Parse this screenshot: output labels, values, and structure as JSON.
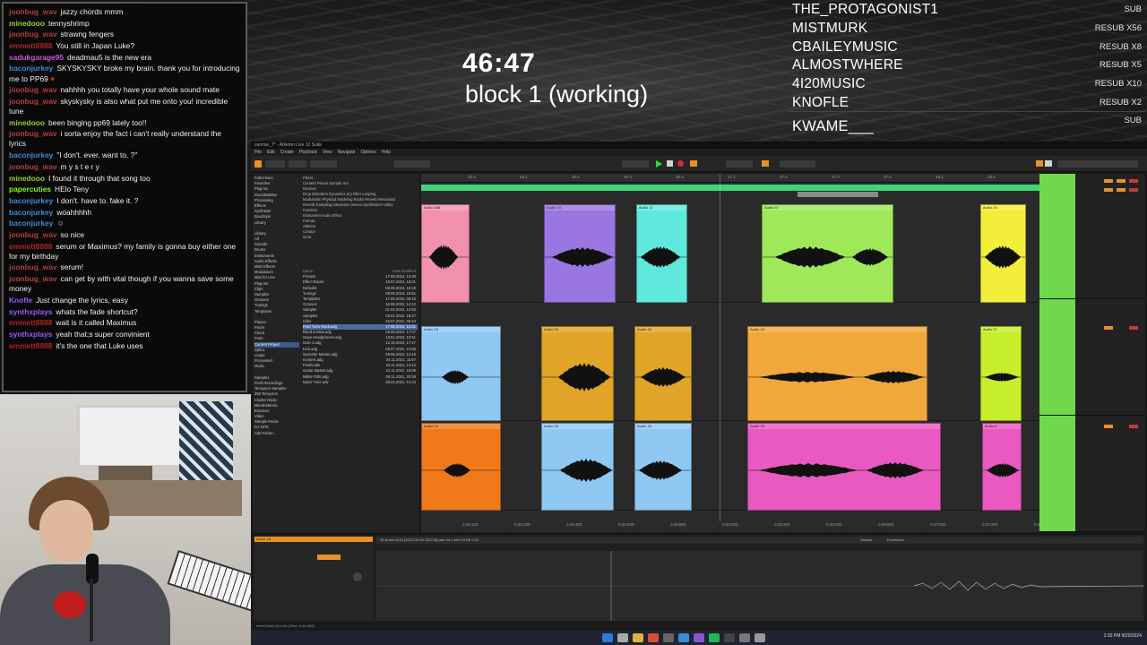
{
  "overlay": {
    "timer": "46:47",
    "block_title": "block 1 (working)"
  },
  "subs": [
    {
      "name": "THE_PROTAGONIST1",
      "tag": "SUB"
    },
    {
      "name": "MISTMURK",
      "tag": "RESUB X56"
    },
    {
      "name": "CBAILEYMUSIC",
      "tag": "RESUB X8"
    },
    {
      "name": "ALMOSTWHERE",
      "tag": "RESUB X5"
    },
    {
      "name": "4I20MUSIC",
      "tag": "RESUB X10"
    },
    {
      "name": "KNOFLE",
      "tag": "RESUB X2"
    }
  ],
  "sub_last": {
    "name": "KWAME___",
    "tag": "SUB"
  },
  "chat": [
    {
      "user": "joonbug_wav",
      "color": "#b0413e",
      "text": "jazzy chords mmm"
    },
    {
      "user": "minedooo",
      "color": "#9acd32",
      "text": "tennyshrimp"
    },
    {
      "user": "joonbug_wav",
      "color": "#b0413e",
      "text": "strawng fengers"
    },
    {
      "user": "emmett8888",
      "color": "#b22222",
      "text": "You still in Japan Luke?"
    },
    {
      "user": "sadukgarage95",
      "color": "#cf57cf",
      "text": "deadmau5 is the new era"
    },
    {
      "user": "baconjurkey",
      "color": "#3f8ad8",
      "text": "SKYSKYSKY broke my brain. thank you for introducing me to PP69"
    },
    {
      "user": "joonbug_wav",
      "color": "#b0413e",
      "text": "nahhhh you totally have your whole sound mate"
    },
    {
      "user": "joonbug_wav",
      "color": "#b0413e",
      "text": "skyskysky is also what put me onto you! incredible tune"
    },
    {
      "user": "minedooo",
      "color": "#9acd32",
      "text": "been binging pp69 lately too!!"
    },
    {
      "user": "joonbug_wav",
      "color": "#b0413e",
      "text": "i sorta enjoy the fact i can't really understand the lyrics"
    },
    {
      "user": "baconjurkey",
      "color": "#3f8ad8",
      "text": "\"I don't. ever. want to. ?\""
    },
    {
      "user": "joonbug_wav",
      "color": "#b0413e",
      "text": "m y s t e r y"
    },
    {
      "user": "minedooo",
      "color": "#9acd32",
      "text": "I found it through that song too"
    },
    {
      "user": "papercuties",
      "color": "#7fff00",
      "text": "HElo Teny"
    },
    {
      "user": "baconjurkey",
      "color": "#3f8ad8",
      "text": "I don't. have to. fake it. ?"
    },
    {
      "user": "baconjurkey",
      "color": "#3f8ad8",
      "text": "woahhhhh"
    },
    {
      "user": "baconjurkey",
      "color": "#3f8ad8",
      "text": ""
    },
    {
      "user": "joonbug_wav",
      "color": "#b0413e",
      "text": "so nice"
    },
    {
      "user": "emmett8888",
      "color": "#b22222",
      "text": "serum or Maximus? my family is gonna buy either one for my birthday"
    },
    {
      "user": "joonbug_wav",
      "color": "#b0413e",
      "text": "serum!"
    },
    {
      "user": "joonbug_wav",
      "color": "#b0413e",
      "text": "can get by with vital though if you wanna save some money"
    },
    {
      "user": "Knofle",
      "color": "#9b59ff",
      "text": "Just change the lyrics, easy"
    },
    {
      "user": "synthxplays",
      "color": "#9b59ff",
      "text": "whats the fade shortcut?"
    },
    {
      "user": "emmett8888",
      "color": "#b22222",
      "text": "wait is it called Maximus"
    },
    {
      "user": "synthxplays",
      "color": "#9b59ff",
      "text": "yeah that;s super convinient"
    },
    {
      "user": "emmett8888",
      "color": "#b22222",
      "text": "it's the one that Luke uses"
    }
  ],
  "ableton": {
    "title": "sunrise_7* - Ableton Live 12 Suite",
    "menu": [
      "File",
      "Edit",
      "Create",
      "Playback",
      "View",
      "Navigate",
      "Options",
      "Help"
    ],
    "browser_left": [
      "Collections",
      "Favorites",
      "Plug-ins",
      "SoundsBetter",
      "Processing",
      "Effects",
      "Synthesis",
      "Boxdrops",
      "Library",
      "",
      "Library",
      "All",
      "Sounds",
      "Drums",
      "Instruments",
      "Audio Effects",
      "MIDI Effects",
      "Modulators",
      "Max for Live",
      "Plug-Ins",
      "Clips",
      "Samples",
      "Grooves",
      "Tunings",
      "Templates",
      "",
      "Places",
      "Packs",
      "Cloud",
      "Push",
      "Current Project",
      "Splice",
      "Loops",
      "Processed",
      "Music",
      "",
      "Samples",
      "Field Recordings",
      "Tennyson Samples",
      "250 Tennyson",
      "Cluster Music",
      "MicrobeMusic",
      "Bounces",
      "Video",
      "Sample Packs",
      "DJ 1978",
      "Add Folder..."
    ],
    "browser_tags": [
      "Filters",
      "Content  Preset  Sample  Set",
      "Devices",
      "Drop  Distortion  Dynamics  EQ  Filter  Looping",
      "Modulation  Physical Modeling  Racks  Reverb  Resonator",
      "Reverb  Sampling  Saturators  Stereo  Synthesizer  Utility",
      "Function",
      "Instrument  Audio Effect",
      "Format",
      "Ableton",
      "Creator",
      "Gear"
    ],
    "file_header": [
      "Name",
      "Date Modified"
    ],
    "files": [
      {
        "name": "Presets",
        "date": "17.08.2024, 13:28"
      },
      {
        "name": "Effect Racks",
        "date": "16.07.2024, 15:01"
      },
      {
        "name": "Defaults",
        "date": "08.06.2024, 16:18"
      },
      {
        "name": "Tunings",
        "date": "08.06.2024, 15:51"
      },
      {
        "name": "Templates",
        "date": "17.06.2022, 08:25"
      },
      {
        "name": "Grooves",
        "date": "16.06.2022, 14:12"
      },
      {
        "name": "Sampler",
        "date": "01.02.2022, 12:53"
      },
      {
        "name": "Samples",
        "date": "25.01.2022, 16:27"
      },
      {
        "name": "Clips",
        "date": "25.07.2021, 05:24"
      },
      {
        "name": "Fred Tune Rack.adg",
        "date": "17.08.2024, 14:01"
      },
      {
        "name": "Rand & Mow.adg",
        "date": "26.06.2024, 17:27"
      },
      {
        "name": "Gayo Headphones.adg",
        "date": "13.01.2023, 13:51"
      },
      {
        "name": "Gain 1.adg",
        "date": "12.10.2022, 17:27"
      },
      {
        "name": "Kick.adg",
        "date": "08.07.2022, 10:59"
      },
      {
        "name": "Synester Master.adg",
        "date": "09.05.2022, 12:16"
      },
      {
        "name": "Invisers.adg",
        "date": "24.11.2021, 11:57"
      },
      {
        "name": "Pixels.adv",
        "date": "22.11.2021, 14:12"
      },
      {
        "name": "Guitar Master.adg",
        "date": "21.11.2021, 18:09"
      },
      {
        "name": "MEM-7000.adg",
        "date": "08.11.2021, 20:29"
      },
      {
        "name": "Noter Tune.adv",
        "date": "28.03.2021, 13:44"
      }
    ],
    "ruler": [
      "25.4",
      "26.1",
      "26.2",
      "26.3",
      "26.4",
      "27.1",
      "27.2",
      "27.3",
      "27.4",
      "28.1",
      "28.2",
      "28.3"
    ],
    "time_ruler": [
      "0:46:100",
      "0:46:200",
      "0:46:400",
      "0:46:600",
      "0:46:800",
      "0:48:000",
      "0:48:200",
      "0:48:400",
      "0:48:600",
      "0:47:000",
      "0:47:200",
      "0:47:400"
    ],
    "top_bar_label": "C#4_P69_sunrh_Pre_Refrain_Vocal_Grpp_Chorus",
    "detail_header": "18-Audio 0224 [2024-09-18 128718].wav  44.1 kHz  24 Bit  1 Ch",
    "detail_tabs": [
      "Sample",
      "Envelopes"
    ],
    "status": "Insert Mark 25.4.4e (Time: 0:46:208)",
    "selected_clip": "Audio 18",
    "taskbar_time": "2:20 PM",
    "taskbar_date": "8/20/2024"
  }
}
